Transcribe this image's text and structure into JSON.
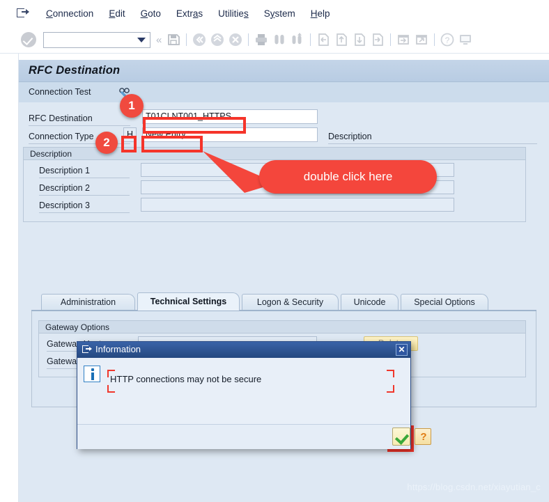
{
  "menubar": {
    "exit_icon": "exit-icon",
    "items": [
      {
        "label": "Connection",
        "accel_index": 0
      },
      {
        "label": "Edit",
        "accel_index": 0
      },
      {
        "label": "Goto",
        "accel_index": 0
      },
      {
        "label": "Extras",
        "accel_index": 4
      },
      {
        "label": "Utilities",
        "accel_index": 7
      },
      {
        "label": "System",
        "accel_index": 1
      },
      {
        "label": "Help",
        "accel_index": 0
      }
    ]
  },
  "toolbar": {
    "enter_icon": "enter-check-icon",
    "command_field_value": "",
    "command_field_placeholder": "",
    "dropdown_icon": "chevron-down-icon",
    "collapse_icon": "double-chevron-left-icon",
    "icons": [
      "save-icon",
      "back-icon",
      "exit-up-icon",
      "cancel-icon",
      "print-icon",
      "find-icon",
      "find-next-icon",
      "first-page-icon",
      "previous-page-icon",
      "next-page-icon",
      "last-page-icon",
      "new-window-icon",
      "create-session-icon",
      "help-icon",
      "customize-local-layout-icon"
    ]
  },
  "screen": {
    "title": "RFC Destination",
    "connection_test": {
      "label": "Connection Test",
      "icon": "glasses-test-icon"
    },
    "fields": {
      "rfc_destination_label": "RFC Destination",
      "rfc_destination_value": "T01CLNT001_HTTPS",
      "connection_type_label": "Connection Type",
      "connection_type_value": "H",
      "connection_name_value": "New Entry",
      "description_side_label": "Description"
    },
    "description_group": {
      "title": "Description",
      "rows": [
        {
          "label": "Description 1",
          "value": ""
        },
        {
          "label": "Description 2",
          "value": ""
        },
        {
          "label": "Description 3",
          "value": ""
        }
      ]
    },
    "tabs": [
      {
        "label": "Administration",
        "active": false
      },
      {
        "label": "Technical Settings",
        "active": true
      },
      {
        "label": "Logon & Security",
        "active": false
      },
      {
        "label": "Unicode",
        "active": false
      },
      {
        "label": "Special Options",
        "active": false
      }
    ],
    "gateway_group": {
      "title": "Gateway Options",
      "rows": [
        {
          "label": "Gateway Host",
          "value": ""
        },
        {
          "label": "Gateway service",
          "value": ""
        }
      ],
      "delete_button": "Delete"
    }
  },
  "dialog": {
    "title": "Information",
    "title_icon": "dialog-window-icon",
    "close_icon": "close-icon",
    "info_icon": "info-icon",
    "message": "HTTP connections may not be secure",
    "confirm_icon": "green-check-icon",
    "help_icon": "orange-question-icon"
  },
  "annotations": {
    "badge_1": "1",
    "badge_2": "2",
    "callout_text": "double click here"
  },
  "watermark": "https://blog.csdn.net/xiayutian_c",
  "colors": {
    "accent_red": "#f4463c",
    "title_blue": "#24487f",
    "panel_blue": "#dee8f3",
    "header_blue": "#b8cce3"
  }
}
